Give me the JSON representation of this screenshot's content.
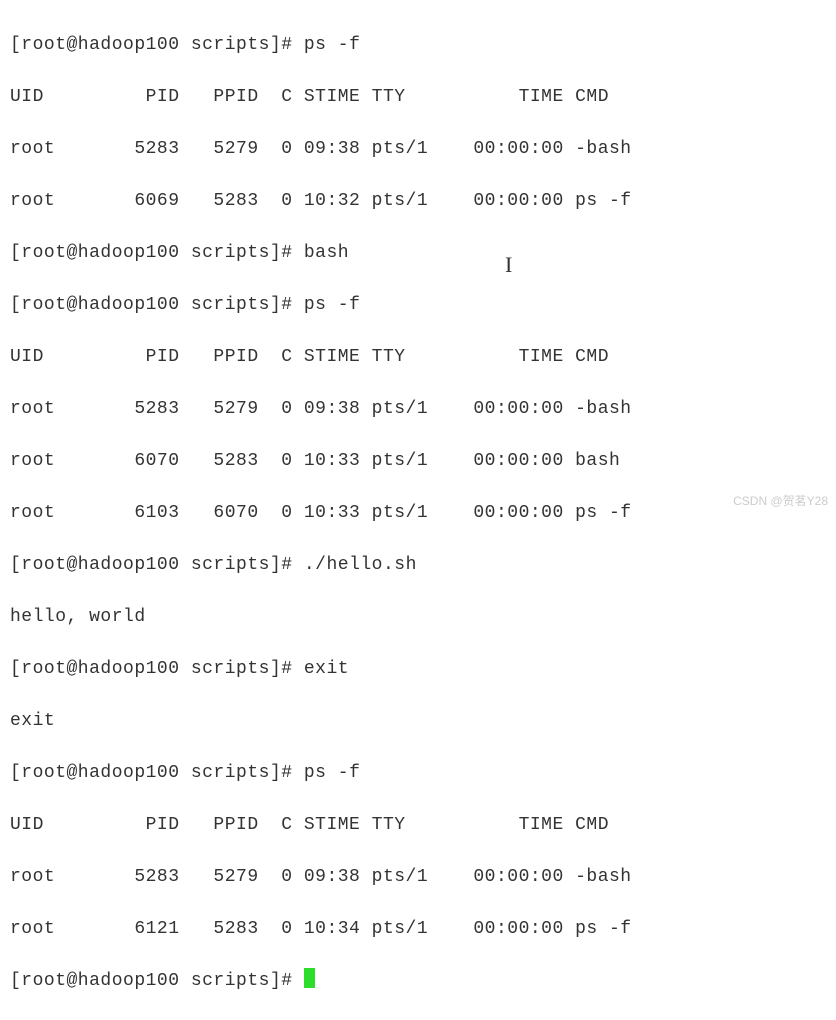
{
  "prompt": "[root@hadoop100 scripts]#",
  "commands": {
    "psf": "ps -f",
    "bash": "bash",
    "hello": "./hello.sh",
    "exit": "exit"
  },
  "ps_header": "UID         PID   PPID  C STIME TTY          TIME CMD",
  "outputs": {
    "block1": [
      "root       5283   5279  0 09:38 pts/1    00:00:00 -bash",
      "root       6069   5283  0 10:32 pts/1    00:00:00 ps -f"
    ],
    "block2": [
      "root       5283   5279  0 09:38 pts/1    00:00:00 -bash",
      "root       6070   5283  0 10:33 pts/1    00:00:00 bash",
      "root       6103   6070  0 10:33 pts/1    00:00:00 ps -f"
    ],
    "hello_out": "hello, world",
    "exit_out": "exit",
    "block3": [
      "root       5283   5279  0 09:38 pts/1    00:00:00 -bash",
      "root       6121   5283  0 10:34 pts/1    00:00:00 ps -f"
    ]
  },
  "watermark": "CSDN @贺茗Y28"
}
